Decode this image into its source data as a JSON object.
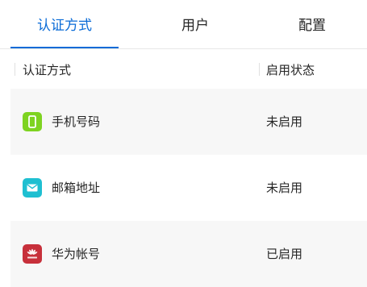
{
  "tabs": [
    {
      "label": "认证方式",
      "active": true
    },
    {
      "label": "用户",
      "active": false
    },
    {
      "label": "配置",
      "active": false
    }
  ],
  "table": {
    "columns": [
      "认证方式",
      "启用状态"
    ],
    "rows": [
      {
        "icon": "mobile-phone-icon",
        "name": "手机号码",
        "status": "未启用"
      },
      {
        "icon": "email-envelope-icon",
        "name": "邮箱地址",
        "status": "未启用"
      },
      {
        "icon": "huawei-logo-icon",
        "name": "华为帐号",
        "status": "已启用"
      }
    ]
  },
  "colors": {
    "accent": "#0a6bd7",
    "phone_icon": "#7ed321",
    "email_icon": "#1fbfd1",
    "huawei_icon": "#c7303b"
  }
}
